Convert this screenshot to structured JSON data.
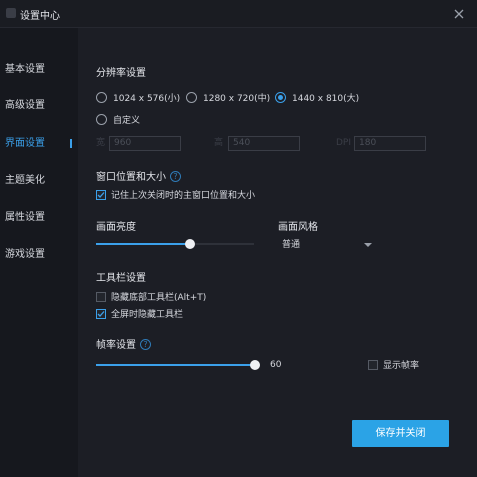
{
  "window": {
    "title": "设置中心"
  },
  "sidebar": {
    "items": [
      {
        "label": "基本设置"
      },
      {
        "label": "高级设置"
      },
      {
        "label": "界面设置"
      },
      {
        "label": "主题美化"
      },
      {
        "label": "属性设置"
      },
      {
        "label": "游戏设置"
      }
    ],
    "active_index": 2
  },
  "resolution": {
    "title": "分辨率设置",
    "options": [
      {
        "label": "1024 x 576(小)",
        "selected": false
      },
      {
        "label": "1280 x 720(中)",
        "selected": false
      },
      {
        "label": "1440 x 810(大)",
        "selected": true
      },
      {
        "label": "自定义",
        "selected": false
      }
    ],
    "custom_fields": [
      {
        "prefix": "宽",
        "value": "960"
      },
      {
        "prefix": "高",
        "value": "540"
      },
      {
        "prefix": "DPI",
        "value": "180"
      }
    ]
  },
  "window_position": {
    "title": "窗口位置和大小",
    "help": "?",
    "remember_label": "记住上次关闭时的主窗口位置和大小",
    "remember_checked": true
  },
  "brightness": {
    "title": "画面亮度",
    "level": 0.6
  },
  "style": {
    "title": "画面风格",
    "value": "普通"
  },
  "toolbar": {
    "title": "工具栏设置",
    "hide_bottom_label": "隐藏底部工具栏(Alt+T)",
    "hide_bottom_checked": false,
    "hide_fullscreen_label": "全屏时隐藏工具栏",
    "hide_fullscreen_checked": true
  },
  "framerate": {
    "title": "帧率设置",
    "help": "?",
    "value": "60",
    "level": 1.0,
    "show_fps_label": "显示帧率",
    "show_fps_checked": false
  },
  "actions": {
    "save_label": "保存并关闭"
  },
  "colors": {
    "accent": "#3ba0ea",
    "background": "#1c1e25",
    "sidebar": "#16181e",
    "button": "#2ba3e6"
  }
}
